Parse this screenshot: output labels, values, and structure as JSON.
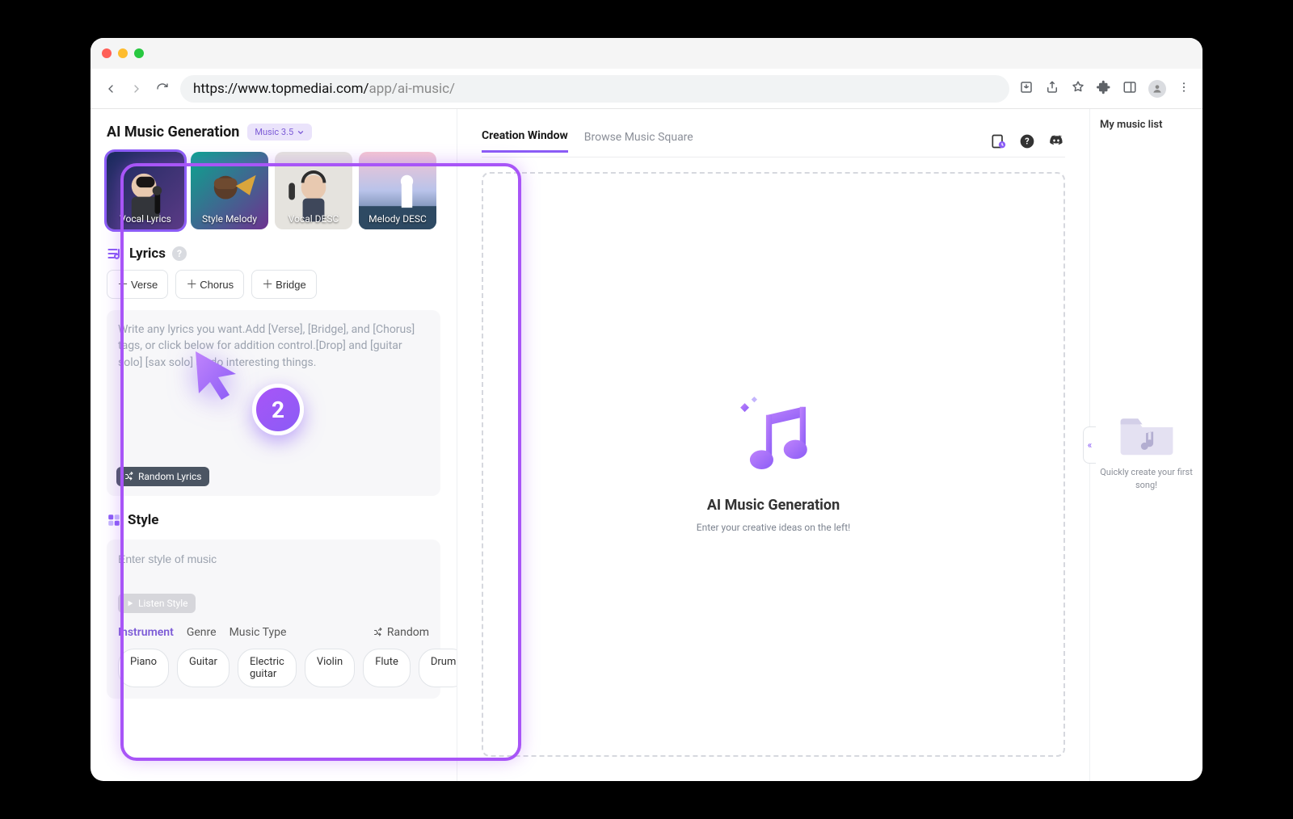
{
  "browser": {
    "url_base": "https://www.topmediai.com/",
    "url_path": "app/ai-music/"
  },
  "sidebar": {
    "title": "AI Music Generation",
    "version_pill": "Music 3.5",
    "modes": [
      {
        "label": "Vocal Lyrics"
      },
      {
        "label": "Style Melody"
      },
      {
        "label": "Vocal DESC"
      },
      {
        "label": "Melody DESC"
      }
    ],
    "lyrics": {
      "section_title": "Lyrics",
      "tags": [
        {
          "label": "Verse"
        },
        {
          "label": "Chorus"
        },
        {
          "label": "Bridge"
        }
      ],
      "placeholder": "Write any lyrics you want.Add [Verse], [Bridge], and [Chorus] tags, or click below for addition control.[Drop] and [guitar solo] [sax solo] all do interesting things.",
      "random_label": "Random Lyrics"
    },
    "style": {
      "section_title": "Style",
      "input_placeholder": "Enter style of music",
      "listen_label": "Listen Style",
      "tabs": [
        {
          "label": "Instrument",
          "active": true
        },
        {
          "label": "Genre"
        },
        {
          "label": "Music Type"
        }
      ],
      "random_label": "Random",
      "chips": [
        "Piano",
        "Guitar",
        "Electric guitar",
        "Violin",
        "Flute",
        "Drum"
      ]
    }
  },
  "main": {
    "tabs": [
      {
        "label": "Creation Window",
        "active": true
      },
      {
        "label": "Browse Music Square"
      }
    ],
    "dropzone": {
      "title": "AI Music Generation",
      "subtitle": "Enter your creative ideas on the left!"
    }
  },
  "right": {
    "title": "My music list",
    "hint": "Quickly create your first song!"
  },
  "annotation": {
    "step": "2"
  }
}
